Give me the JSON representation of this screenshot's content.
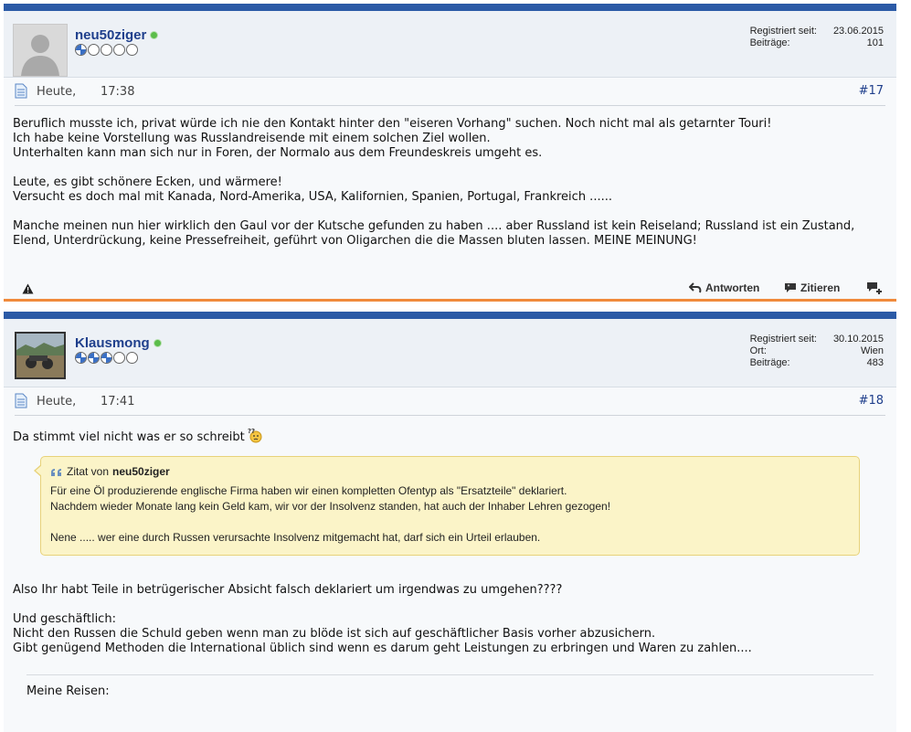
{
  "posts": [
    {
      "username": "neu50ziger",
      "rank_filled": 1,
      "rank_total": 5,
      "info": [
        {
          "label": "Registriert seit:",
          "value": "23.06.2015"
        },
        {
          "label": "Beiträge:",
          "value": "101"
        }
      ],
      "date": "Heute,",
      "time": "17:38",
      "number": "#17",
      "body": {
        "p1": [
          "Beruflich musste ich, privat würde ich nie den Kontakt hinter den \"eiseren Vorhang\" suchen. Noch nicht mal als getarnter Touri!",
          "Ich habe keine Vorstellung was Russlandreisende mit einem solchen Ziel wollen.",
          "Unterhalten kann man sich nur in Foren, der Normalo aus dem Freundeskreis umgeht es."
        ],
        "p2": [
          "Leute, es gibt schönere Ecken, und wärmere!",
          "Versucht es doch mal mit Kanada, Nord-Amerika, USA, Kalifornien, Spanien, Portugal, Frankreich ......"
        ],
        "p3": [
          "Manche meinen nun hier wirklich den Gaul vor der Kutsche gefunden zu haben .... aber Russland ist kein Reiseland; Russland ist ein Zustand,",
          "Elend, Unterdrückung, keine Pressefreiheit, geführt von Oligarchen die die Massen bluten lassen. MEINE MEINUNG!"
        ]
      },
      "actions": {
        "reply": "Antworten",
        "quote": "Zitieren"
      }
    },
    {
      "username": "Klausmong",
      "rank_filled": 3,
      "rank_total": 5,
      "info": [
        {
          "label": "Registriert seit:",
          "value": "30.10.2015"
        },
        {
          "label": "Ort:",
          "value": "Wien"
        },
        {
          "label": "Beiträge:",
          "value": "483"
        }
      ],
      "date": "Heute,",
      "time": "17:41",
      "number": "#18",
      "intro": "Da stimmt viel nicht was er so schreibt",
      "quote": {
        "prefix": "Zitat von",
        "author": "neu50ziger",
        "lines": [
          "Für eine Öl produzierende englische Firma haben wir einen kompletten Ofentyp als \"Ersatzteile\" deklariert.",
          "Nachdem wieder Monate lang kein Geld kam, wir vor der Insolvenz standen, hat auch der Inhaber Lehren gezogen!"
        ],
        "last": "Nene ..... wer eine durch Russen verursachte Insolvenz mitgemacht hat, darf sich ein Urteil erlauben."
      },
      "body": {
        "p1": [
          "Also Ihr habt Teile in betrügerischer Absicht falsch deklariert um irgendwas zu umgehen????"
        ],
        "p2": [
          "Und geschäftlich:",
          "Nicht den Russen die Schuld geben wenn man zu blöde ist sich auf geschäftlicher Basis vorher abzusichern.",
          "Gibt genügend Methoden die International üblich sind wenn es darum geht Leistungen zu erbringen und Waren zu zahlen...."
        ]
      },
      "signature": "Meine Reisen:"
    }
  ],
  "colors": {
    "header_bar": "#2b5aa6",
    "divider": "#f08a3c",
    "username": "#1f3f8c",
    "quote_bg": "#fbf4c8"
  }
}
